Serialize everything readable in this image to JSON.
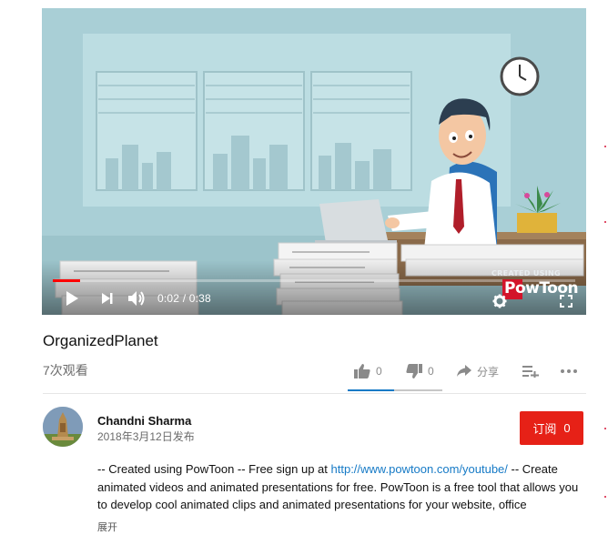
{
  "player": {
    "time_current": "0:02",
    "time_total": "0:38",
    "time_separator": " / ",
    "progress": 0.0526,
    "watermark_small": "CREATED USING",
    "watermark_logo": "PowToon",
    "accent_color": "#ff0000"
  },
  "video": {
    "title": "OrganizedPlanet",
    "views": "7次观看"
  },
  "actions": {
    "like_count": "0",
    "dislike_count": "0",
    "share_label": "分享"
  },
  "channel": {
    "name": "Chandni Sharma",
    "publish_date": "2018年3月12日发布"
  },
  "subscribe": {
    "label": "订阅",
    "count": "0",
    "color": "#e62117"
  },
  "description": {
    "text_before_link": "-- Created using PowToon -- Free sign up at ",
    "link": "http://www.powtoon.com/youtube/",
    "text_after_link": " -- Create animated videos and animated presentations for free.  PowToon is a free tool that allows you to develop cool animated clips and animated presentations for your website, office",
    "expand_label": "展开",
    "link_color": "#167ac6"
  }
}
